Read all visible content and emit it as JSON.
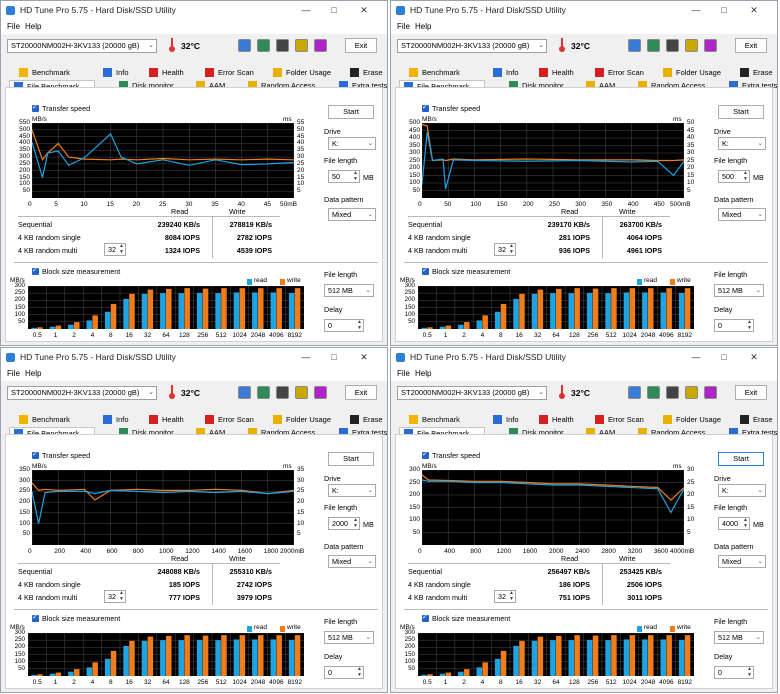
{
  "app": {
    "title": "HD Tune Pro 5.75 - Hard Disk/SSD Utility",
    "menu": [
      "File",
      "Help"
    ],
    "drive": "ST20000NM002H-3KV133 (20000 gB)",
    "temperature": "32°C",
    "exit_label": "Exit",
    "tabs_row1": [
      "Benchmark",
      "Info",
      "Health",
      "Error Scan",
      "Folder Usage",
      "Erase"
    ],
    "tabs_row2": [
      "File Benchmark",
      "Disk monitor",
      "AAM",
      "Random Access",
      "Extra tests"
    ],
    "transfer_speed_label": "Transfer speed",
    "mbs_label": "MB/s",
    "ms_label": "ms",
    "start_label": "Start",
    "drive_label": "Drive",
    "drive_letter": "K:",
    "file_length_label": "File length",
    "mb_unit": "MB",
    "data_pattern_label": "Data pattern",
    "data_pattern_value": "Mixed",
    "read_header": "Read",
    "write_header": "Write",
    "sequential_label": "Sequential",
    "random_single_label": "4 KB random single",
    "random_multi_label": "4 KB random multi",
    "queue_depth": "32",
    "block_size_label": "Block size measurement",
    "legend_read": "read",
    "legend_write": "write",
    "bs_file_length_label": "File length",
    "bs_file_length_value": "512 MB",
    "delay_label": "Delay",
    "delay_value": "0",
    "block_sizes": [
      "0.5",
      "1",
      "2",
      "4",
      "8",
      "16",
      "32",
      "64",
      "128",
      "256",
      "512",
      "1024",
      "2048",
      "4096",
      "8192"
    ],
    "bs_yticks": [
      "300",
      "250",
      "200",
      "150",
      "100",
      "50"
    ]
  },
  "colors": {
    "read": "#1ea3e3",
    "write": "#f07d1a",
    "plot_bg": "#000000",
    "grid": "#4a4a4a"
  },
  "windows": [
    {
      "file_length": "50",
      "seq_read": "239240 KB/s",
      "seq_write": "278819 KB/s",
      "single_read": "8084 IOPS",
      "single_write": "2782 IOPS",
      "multi_read": "1324 IOPS",
      "multi_write": "4539 IOPS",
      "ts_yticks": [
        "550",
        "500",
        "450",
        "400",
        "350",
        "300",
        "250",
        "200",
        "150",
        "100",
        "50"
      ],
      "ts_msticks": [
        "55",
        "50",
        "45",
        "40",
        "35",
        "30",
        "25",
        "20",
        "15",
        "10",
        "5"
      ],
      "ts_xticks": [
        "0",
        "5",
        "10",
        "15",
        "20",
        "25",
        "30",
        "35",
        "40",
        "45",
        "50mB"
      ]
    },
    {
      "file_length": "500",
      "seq_read": "239170 KB/s",
      "seq_write": "263700 KB/s",
      "single_read": "281 IOPS",
      "single_write": "4064 IOPS",
      "multi_read": "936 IOPS",
      "multi_write": "4961 IOPS",
      "ts_yticks": [
        "500",
        "450",
        "400",
        "350",
        "300",
        "250",
        "200",
        "150",
        "100",
        "50"
      ],
      "ts_msticks": [
        "50",
        "45",
        "40",
        "35",
        "30",
        "25",
        "20",
        "15",
        "10",
        "5"
      ],
      "ts_xticks": [
        "0",
        "50",
        "100",
        "150",
        "200",
        "250",
        "300",
        "350",
        "400",
        "450",
        "500mB"
      ]
    },
    {
      "file_length": "2000",
      "seq_read": "248088 KB/s",
      "seq_write": "255310 KB/s",
      "single_read": "185 IOPS",
      "single_write": "2742 IOPS",
      "multi_read": "777 IOPS",
      "multi_write": "3979 IOPS",
      "ts_yticks": [
        "350",
        "300",
        "250",
        "200",
        "150",
        "100",
        "50"
      ],
      "ts_msticks": [
        "35",
        "30",
        "25",
        "20",
        "15",
        "10",
        "5"
      ],
      "ts_xticks": [
        "0",
        "200",
        "400",
        "600",
        "800",
        "1000",
        "1200",
        "1400",
        "1600",
        "1800",
        "2000mB"
      ]
    },
    {
      "file_length": "4000",
      "seq_read": "256497 KB/s",
      "seq_write": "253425 KB/s",
      "single_read": "186 IOPS",
      "single_write": "2506 IOPS",
      "multi_read": "751 IOPS",
      "multi_write": "3011 IOPS",
      "ts_yticks": [
        "300",
        "250",
        "200",
        "150",
        "100",
        "50"
      ],
      "ts_msticks": [
        "30",
        "25",
        "20",
        "15",
        "10",
        "5"
      ],
      "ts_xticks": [
        "0",
        "400",
        "800",
        "1200",
        "1600",
        "2000",
        "2400",
        "2800",
        "3200",
        "3600",
        "4000mB"
      ]
    }
  ],
  "chart_data": [
    {
      "type": "line",
      "title": "Transfer speed",
      "xlabel": "",
      "ylabel": "MB/s",
      "x": [
        0,
        2,
        3,
        5,
        7,
        10,
        15,
        17,
        20,
        25,
        30,
        35,
        40,
        45,
        50
      ],
      "series": [
        {
          "name": "read",
          "values": [
            410,
            150,
            330,
            345,
            240,
            295,
            470,
            300,
            250,
            280,
            240,
            280,
            245,
            250,
            260
          ]
        },
        {
          "name": "write",
          "values": [
            500,
            280,
            330,
            400,
            300,
            285,
            280,
            285,
            280,
            290,
            280,
            285,
            280,
            285,
            280
          ]
        }
      ],
      "ylim": [
        0,
        550
      ],
      "xlim": [
        0,
        50
      ]
    },
    {
      "type": "line",
      "title": "Transfer speed",
      "xlabel": "",
      "ylabel": "MB/s",
      "x": [
        0,
        10,
        20,
        40,
        45,
        60,
        100,
        200,
        300,
        400,
        450,
        480,
        500
      ],
      "series": [
        {
          "name": "read",
          "values": [
            90,
            440,
            250,
            260,
            60,
            255,
            250,
            245,
            250,
            240,
            245,
            150,
            245
          ]
        },
        {
          "name": "write",
          "values": [
            490,
            480,
            250,
            255,
            250,
            260,
            255,
            260,
            255,
            255,
            250,
            250,
            255
          ]
        }
      ],
      "ylim": [
        0,
        500
      ],
      "xlim": [
        0,
        500
      ]
    },
    {
      "type": "line",
      "title": "Transfer speed",
      "xlabel": "",
      "ylabel": "MB/s",
      "x": [
        0,
        50,
        100,
        200,
        400,
        480,
        600,
        800,
        1000,
        1200,
        1400,
        1600,
        1800,
        2000
      ],
      "series": [
        {
          "name": "read",
          "values": [
            250,
            100,
            245,
            250,
            250,
            240,
            255,
            250,
            245,
            250,
            245,
            250,
            240,
            250
          ]
        },
        {
          "name": "write",
          "values": [
            290,
            255,
            260,
            255,
            260,
            210,
            255,
            260,
            255,
            255,
            260,
            255,
            240,
            255
          ]
        }
      ],
      "ylim": [
        0,
        350
      ],
      "xlim": [
        0,
        2000
      ]
    },
    {
      "type": "line",
      "title": "Transfer speed",
      "xlabel": "",
      "ylabel": "MB/s",
      "x": [
        0,
        100,
        400,
        800,
        1200,
        1600,
        2000,
        2400,
        2800,
        3200,
        3600,
        3800,
        4000
      ],
      "series": [
        {
          "name": "read",
          "values": [
            260,
            255,
            255,
            250,
            250,
            245,
            240,
            240,
            235,
            230,
            225,
            130,
            225
          ]
        },
        {
          "name": "write",
          "values": [
            280,
            260,
            258,
            255,
            255,
            250,
            245,
            245,
            240,
            235,
            230,
            180,
            230
          ]
        }
      ],
      "ylim": [
        0,
        300
      ],
      "xlim": [
        0,
        4000
      ]
    },
    {
      "type": "bar",
      "title": "Block size measurement",
      "xlabel": "",
      "ylabel": "MB/s",
      "categories": [
        "0.5",
        "1",
        "2",
        "4",
        "8",
        "16",
        "32",
        "64",
        "128",
        "256",
        "512",
        "1024",
        "2048",
        "4096",
        "8192"
      ],
      "series": [
        {
          "name": "read",
          "values": [
            8,
            16,
            30,
            60,
            120,
            210,
            245,
            250,
            250,
            252,
            250,
            255,
            255,
            255,
            252
          ]
        },
        {
          "name": "write",
          "values": [
            12,
            24,
            48,
            95,
            175,
            245,
            275,
            280,
            285,
            282,
            285,
            285,
            285,
            285,
            285
          ]
        }
      ],
      "ylim": [
        0,
        300
      ]
    }
  ]
}
